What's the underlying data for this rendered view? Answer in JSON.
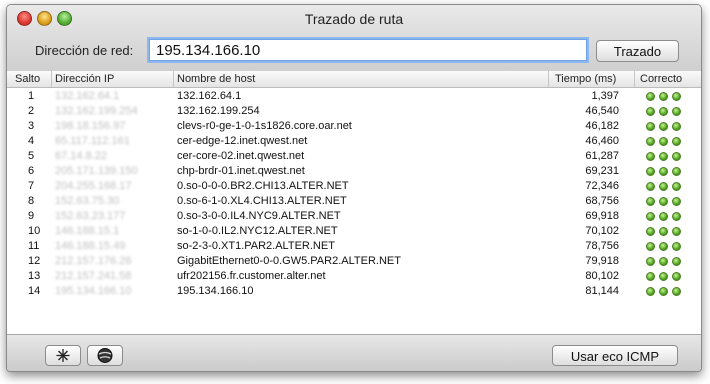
{
  "window": {
    "title": "Trazado de ruta"
  },
  "address": {
    "label": "Dirección de red:",
    "value": "195.134.166.10"
  },
  "buttons": {
    "trace": "Trazado",
    "icmp": "Usar eco ICMP"
  },
  "columns": {
    "hop": "Salto",
    "ip": "Dirección IP",
    "host": "Nombre de host",
    "time": "Tiempo (ms)",
    "ok": "Correcto"
  },
  "rows": [
    {
      "hop": "1",
      "ip": "132.162.64.1",
      "host": "132.162.64.1",
      "time": "1,397"
    },
    {
      "hop": "2",
      "ip": "132.162.199.254",
      "host": "132.162.199.254",
      "time": "46,540"
    },
    {
      "hop": "3",
      "ip": "198.18.156.97",
      "host": "clevs-r0-ge-1-0-1s1826.core.oar.net",
      "time": "46,182"
    },
    {
      "hop": "4",
      "ip": "65.117.112.161",
      "host": "cer-edge-12.inet.qwest.net",
      "time": "46,460"
    },
    {
      "hop": "5",
      "ip": "67.14.8.22",
      "host": "cer-core-02.inet.qwest.net",
      "time": "61,287"
    },
    {
      "hop": "6",
      "ip": "205.171.139.150",
      "host": "chp-brdr-01.inet.qwest.net",
      "time": "69,231"
    },
    {
      "hop": "7",
      "ip": "204.255.168.17",
      "host": "0.so-0-0-0.BR2.CHI13.ALTER.NET",
      "time": "72,346"
    },
    {
      "hop": "8",
      "ip": "152.63.75.30",
      "host": "0.so-6-1-0.XL4.CHI13.ALTER.NET",
      "time": "68,756"
    },
    {
      "hop": "9",
      "ip": "152.63.23.177",
      "host": "0.so-3-0-0.IL4.NYC9.ALTER.NET",
      "time": "69,918"
    },
    {
      "hop": "10",
      "ip": "146.188.15.1",
      "host": "so-1-0-0.IL2.NYC12.ALTER.NET",
      "time": "70,102"
    },
    {
      "hop": "11",
      "ip": "146.188.15.49",
      "host": "so-2-3-0.XT1.PAR2.ALTER.NET",
      "time": "78,756"
    },
    {
      "hop": "12",
      "ip": "212.157.176.26",
      "host": "GigabitEthernet0-0-0.GW5.PAR2.ALTER.NET",
      "time": "79,918"
    },
    {
      "hop": "13",
      "ip": "212.157.241.58",
      "host": "ufr202156.fr.customer.alter.net",
      "time": "80,102"
    },
    {
      "hop": "14",
      "ip": "195.134.166.10",
      "host": "195.134.166.10",
      "time": "81,144"
    }
  ],
  "status_color": "#3d9a10",
  "bottom_icons": [
    "network-utility-icon",
    "globe-icon"
  ]
}
